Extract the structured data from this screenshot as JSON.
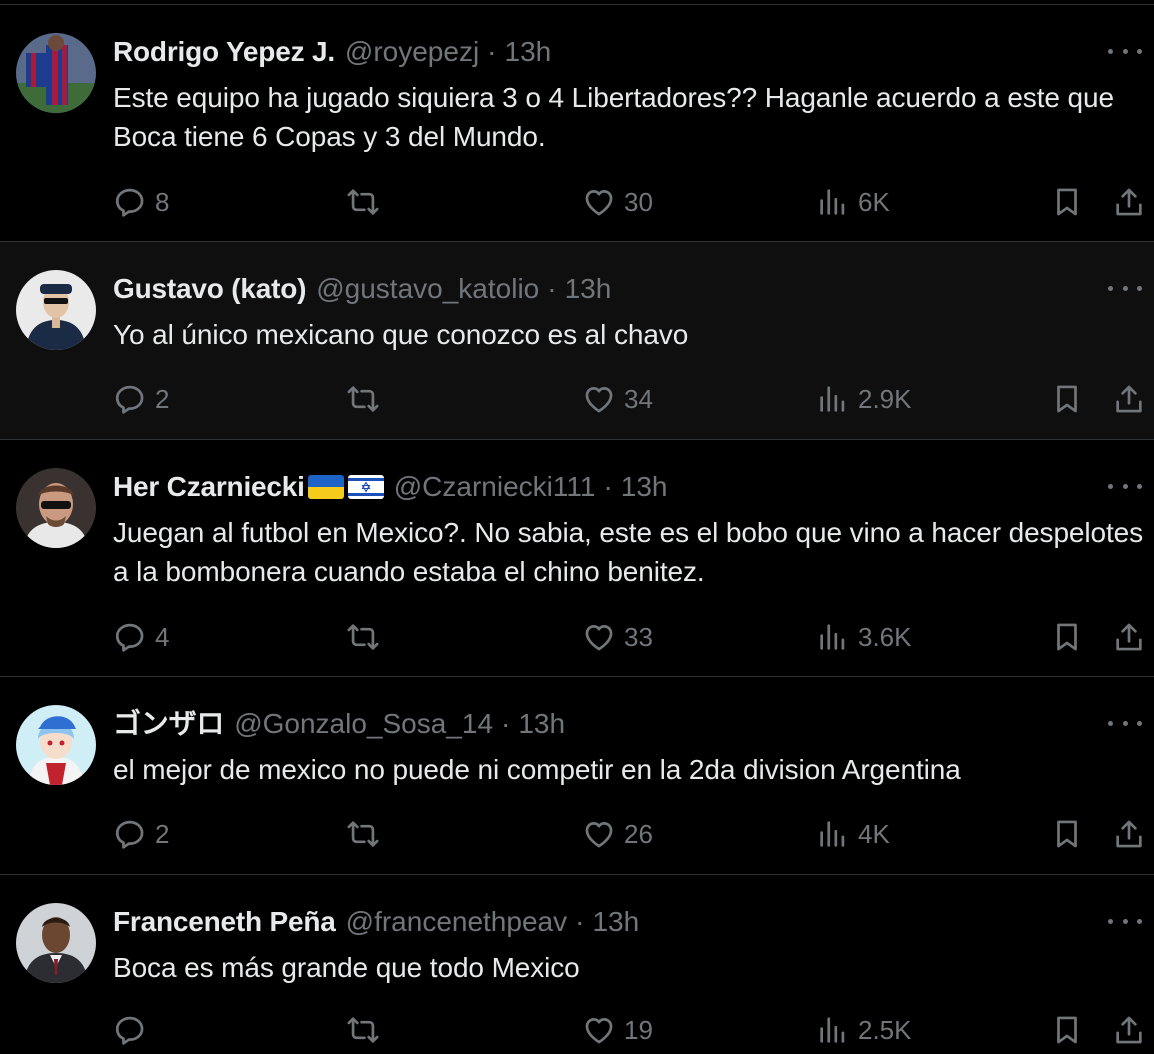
{
  "colors": {
    "background": "#000000",
    "text_primary": "#e7e9ea",
    "text_secondary": "#71767b",
    "divider": "#2f3336"
  },
  "tweets": [
    {
      "name": "Rodrigo Yepez J.",
      "handle": "@royepezj",
      "separator": "·",
      "time": "13h",
      "text": "Este equipo ha jugado siquiera 3 o 4 Libertadores?? Haganle acuerdo a este que Boca tiene 6 Copas y 3 del Mundo.",
      "replies": "8",
      "retweets": "",
      "likes": "30",
      "views": "6K",
      "flags": []
    },
    {
      "name": "Gustavo (kato)",
      "handle": "@gustavo_katolio",
      "separator": "·",
      "time": "13h",
      "text": "Yo al único mexicano que conozco es al chavo",
      "replies": "2",
      "retweets": "",
      "likes": "34",
      "views": "2.9K",
      "flags": []
    },
    {
      "name": "Her Czarniecki",
      "handle": "@Czarniecki111",
      "separator": "·",
      "time": "13h",
      "text": "Juegan al futbol en Mexico?. No sabia, este es el bobo que vino a hacer despelotes a la bombonera cuando estaba el chino benitez.",
      "replies": "4",
      "retweets": "",
      "likes": "33",
      "views": "3.6K",
      "flags": [
        "ukraine-flag",
        "israel-flag"
      ]
    },
    {
      "name": "ゴンザロ",
      "handle": "@Gonzalo_Sosa_14",
      "separator": "·",
      "time": "13h",
      "text": "el mejor de mexico no puede ni competir en la 2da division Argentina",
      "replies": "2",
      "retweets": "",
      "likes": "26",
      "views": "4K",
      "flags": []
    },
    {
      "name": "Franceneth Peña",
      "handle": "@francenethpeav",
      "separator": "·",
      "time": "13h",
      "text": "Boca es más grande que todo Mexico",
      "replies": "",
      "retweets": "",
      "likes": "19",
      "views": "2.5K",
      "flags": []
    }
  ],
  "icons": {
    "reply": "reply-icon",
    "retweet": "retweet-icon",
    "like": "heart-icon",
    "views": "views-icon",
    "bookmark": "bookmark-icon",
    "share": "share-icon",
    "more": "more-icon"
  }
}
